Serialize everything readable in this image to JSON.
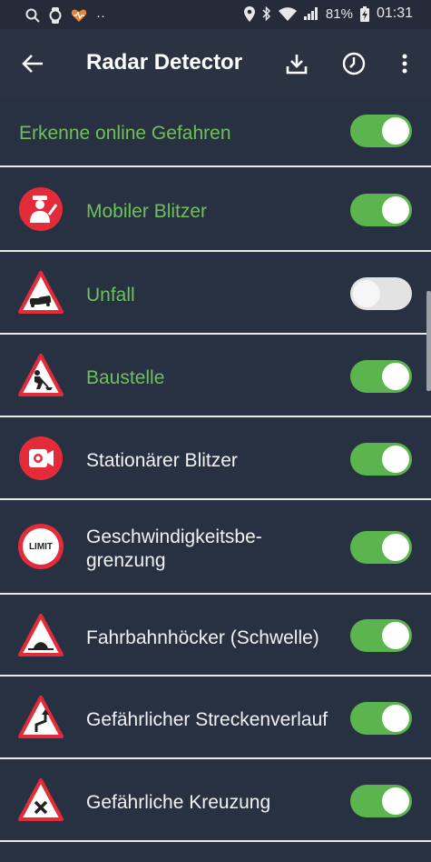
{
  "status_bar": {
    "battery": "81%",
    "time": "01:31",
    "dots": "··"
  },
  "app_bar": {
    "title": "Radar Detector",
    "back_icon": "back-arrow-icon",
    "download_icon": "download-icon",
    "history_icon": "history-icon",
    "more_icon": "more-vertical-icon"
  },
  "settings": {
    "master": {
      "label": "Erkenne online Gefahren",
      "enabled": true
    },
    "items": [
      {
        "label": "Mobiler Blitzer",
        "icon": "police-officer-icon",
        "enabled": true,
        "highlight": true
      },
      {
        "label": "Unfall",
        "icon": "accident-warning-icon",
        "enabled": false,
        "highlight": true
      },
      {
        "label": "Baustelle",
        "icon": "roadworks-warning-icon",
        "enabled": true,
        "highlight": true
      },
      {
        "label": "Stationärer Blitzer",
        "icon": "speed-camera-icon",
        "enabled": true,
        "highlight": false
      },
      {
        "label_line1": "Geschwindigkeitsbe-",
        "label_line2": "grenzung",
        "icon": "speed-limit-icon",
        "icon_text": "LIMIT",
        "enabled": true,
        "highlight": false
      },
      {
        "label": "Fahrbahnhöcker (Schwelle)",
        "icon": "speed-bump-warning-icon",
        "enabled": true,
        "highlight": false
      },
      {
        "label": "Gefährlicher Streckenverlauf",
        "icon": "dangerous-curve-warning-icon",
        "enabled": true,
        "highlight": false
      },
      {
        "label": "Gefährliche Kreuzung",
        "icon": "dangerous-crossing-warning-icon",
        "enabled": true,
        "highlight": false
      }
    ]
  },
  "colors": {
    "background": "#283141",
    "app_bar": "#2b3342",
    "accent_green": "#5cb44f",
    "label_green": "#6fc05a",
    "icon_red": "#e42b3a"
  }
}
